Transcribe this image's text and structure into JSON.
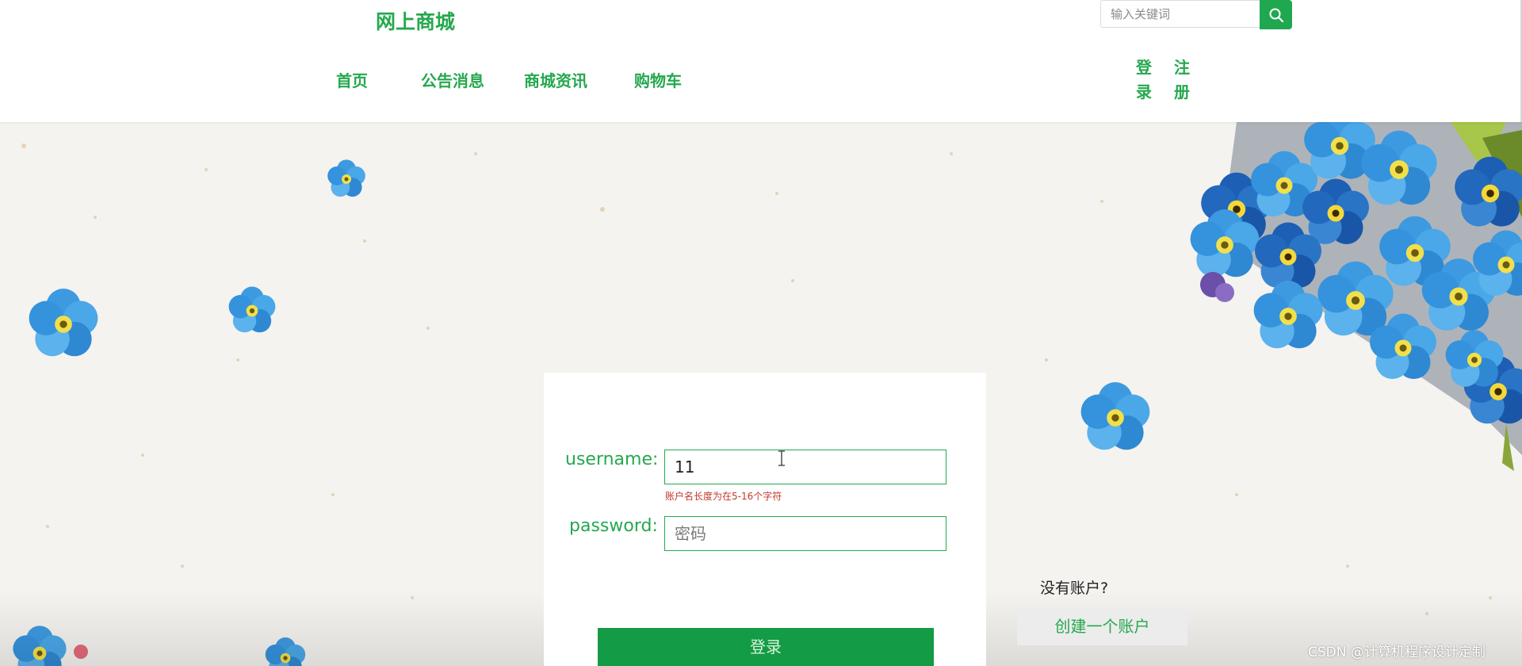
{
  "header": {
    "brand": "网上商城",
    "search": {
      "placeholder": "输入关键词",
      "value": ""
    },
    "nav": [
      {
        "label": "首页"
      },
      {
        "label": "公告消息"
      },
      {
        "label": "商城资讯"
      },
      {
        "label": "购物车"
      }
    ],
    "auth": {
      "login": [
        "登",
        "录"
      ],
      "register": [
        "注",
        "册"
      ]
    }
  },
  "login_form": {
    "username_label": "username:",
    "username_value": "11",
    "username_error": "账户名长度为在5-16个字符",
    "password_label": "password:",
    "password_placeholder": "密码",
    "submit_label": "登录"
  },
  "signup": {
    "prompt": "没有账户?",
    "button_label": "创建一个账户"
  },
  "watermark": "CSDN @计算机程序设计定制",
  "colors": {
    "accent": "#25a84e",
    "button": "#149b45",
    "error": "#c0392b",
    "flower_blue": "#2f8fd8"
  }
}
